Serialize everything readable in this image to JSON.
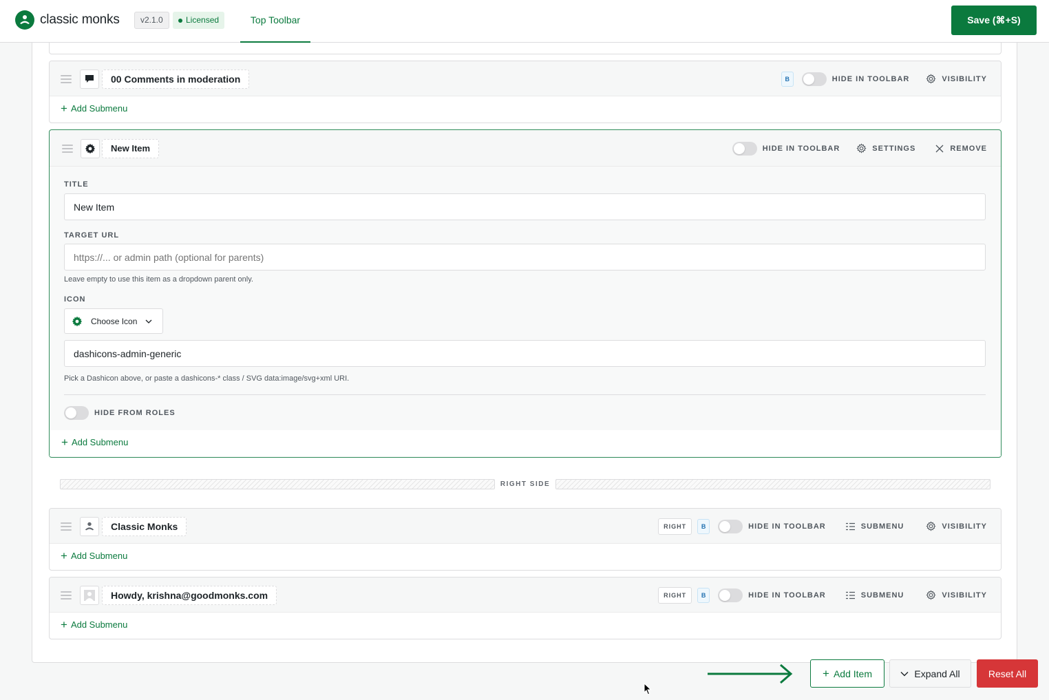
{
  "header": {
    "logo_text": "classic monks",
    "version": "v2.1.0",
    "license_status": "Licensed",
    "active_tab": "Top Toolbar",
    "save_label": "Save (⌘+S)"
  },
  "labels": {
    "hide_in_toolbar": "HIDE IN TOOLBAR",
    "visibility": "VISIBILITY",
    "settings": "SETTINGS",
    "remove": "REMOVE",
    "submenu": "SUBMENU",
    "add_submenu": "Add Submenu",
    "badge_b": "B",
    "badge_right": "RIGHT"
  },
  "items": [
    {
      "title": "00 Comments in moderation",
      "icon": "comment-icon"
    },
    {
      "title": "New Item",
      "icon": "gear-icon"
    },
    {
      "title": "Classic Monks",
      "icon": "monk-icon"
    },
    {
      "title": "Howdy, krishna@goodmonks.com",
      "icon": "avatar-icon"
    }
  ],
  "editor": {
    "title_label": "TITLE",
    "title_value": "New Item",
    "url_label": "TARGET URL",
    "url_placeholder": "https://... or admin path (optional for parents)",
    "url_help": "Leave empty to use this item as a dropdown parent only.",
    "icon_label": "ICON",
    "choose_icon": "Choose Icon",
    "icon_value": "dashicons-admin-generic",
    "icon_help": "Pick a Dashicon above, or paste a dashicons-* class / SVG data:image/svg+xml URI.",
    "hide_roles_label": "HIDE FROM ROLES"
  },
  "divider": {
    "label": "RIGHT SIDE"
  },
  "footer": {
    "add_item": "Add Item",
    "expand_all": "Expand All",
    "reset_all": "Reset All"
  },
  "colors": {
    "brand": "#0b7a3e",
    "danger": "#d63638",
    "badge_blue": "#2271b1"
  }
}
